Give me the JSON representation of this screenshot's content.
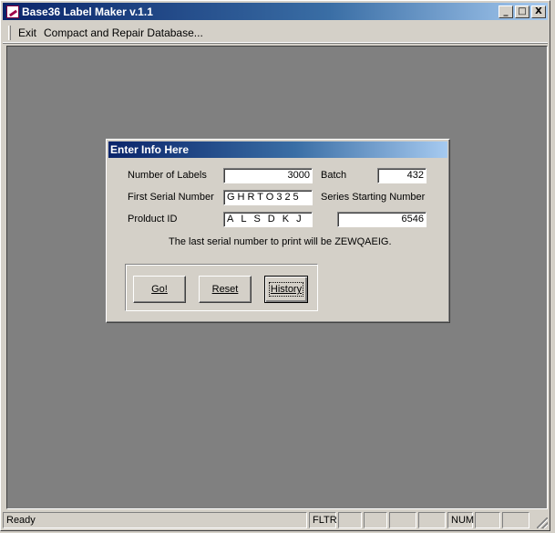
{
  "window": {
    "title": "Base36 Label Maker v.1.1",
    "buttons": {
      "minimize": "_",
      "maximize": "□",
      "close": "X"
    }
  },
  "menu": {
    "items": [
      "Exit",
      "Compact and Repair Database..."
    ]
  },
  "dialog": {
    "title": "Enter Info Here",
    "number_of_labels": {
      "label": "Number of Labels",
      "value": "3000"
    },
    "batch": {
      "label": "Batch",
      "value": "432"
    },
    "first_serial": {
      "label": "First Serial Number",
      "value": "GHRTO325"
    },
    "series_start": {
      "label": "Series Starting Number",
      "value": "6546"
    },
    "product_id": {
      "label": "Prolduct ID",
      "value": "ALSDKJ"
    },
    "last_serial_message": "The last serial number to print will be ZEWQAEIG.",
    "buttons": {
      "go": "Go!",
      "reset": "Reset",
      "history": "History"
    }
  },
  "statusbar": {
    "status": "Ready",
    "fltr": "FLTR",
    "num": "NUM"
  }
}
